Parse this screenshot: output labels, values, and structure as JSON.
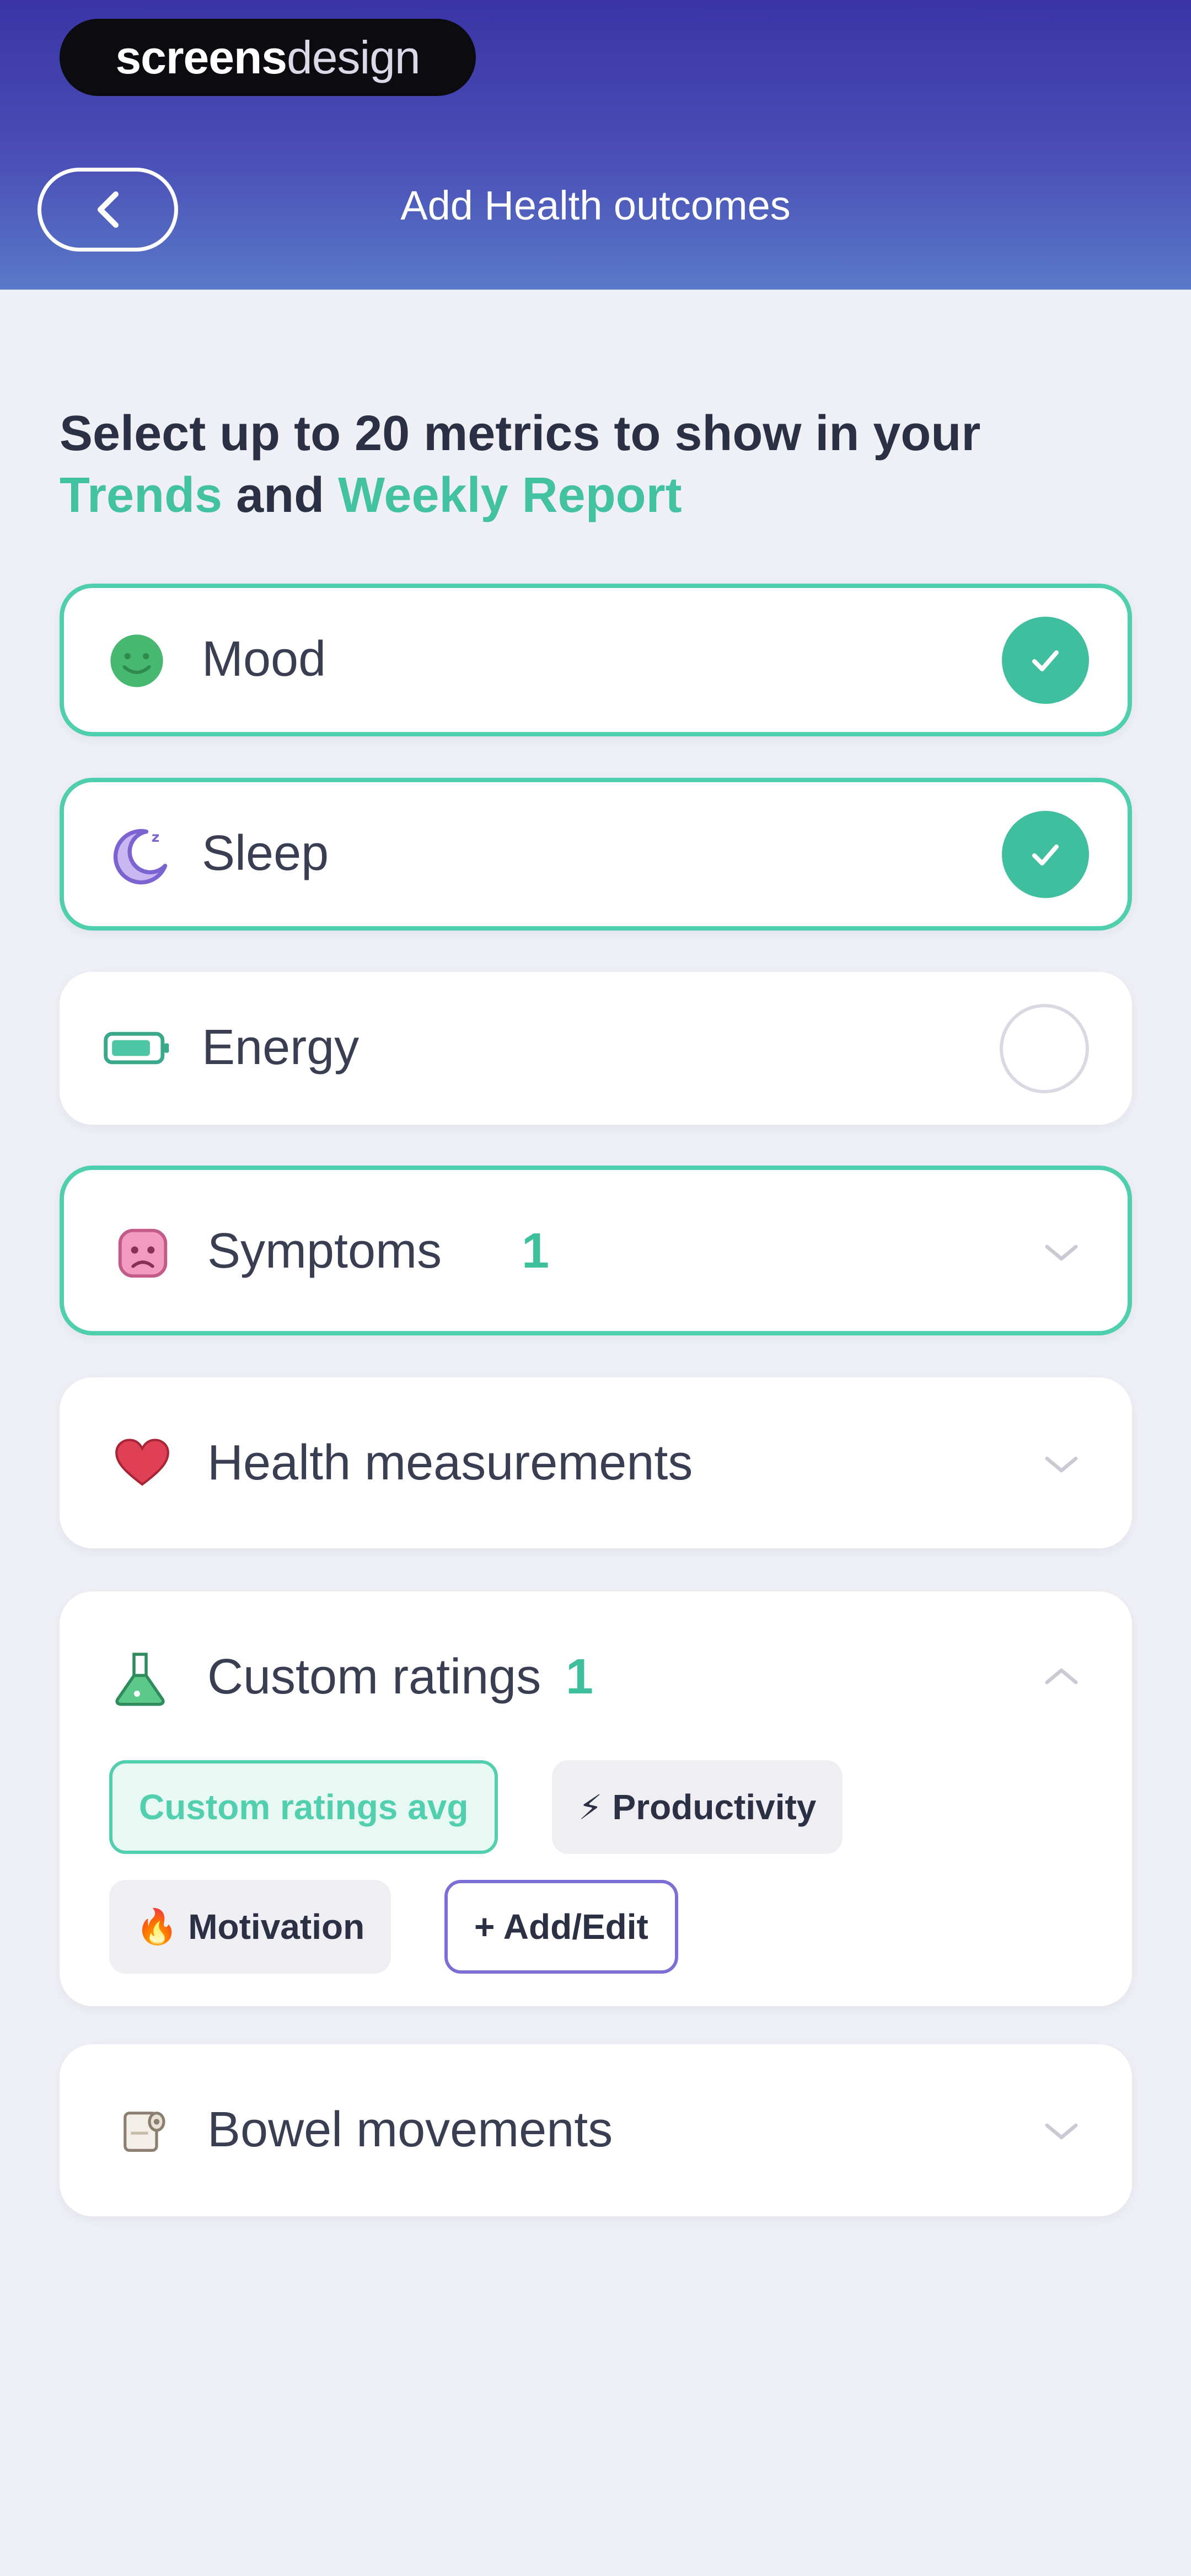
{
  "brand": {
    "strong": "screens",
    "light": "design"
  },
  "header": {
    "title": "Add Health outcomes",
    "back_icon": "chevron-left-icon"
  },
  "intro": {
    "line1": "Select up to 20 metrics to show in your",
    "trends": "Trends",
    "and": " and ",
    "weekly_report": "Weekly Report"
  },
  "metrics": [
    {
      "label": "Mood",
      "icon": "mood-face-icon",
      "state": "checked"
    },
    {
      "label": "Sleep",
      "icon": "moon-icon",
      "state": "checked"
    },
    {
      "label": "Energy",
      "icon": "battery-icon",
      "state": "unchecked"
    }
  ],
  "sections": {
    "symptoms": {
      "label": "Symptoms",
      "count": "1",
      "icon": "symptoms-icon",
      "state": "collapsed"
    },
    "health_measurements": {
      "label": "Health measurements",
      "icon": "heart-icon",
      "state": "collapsed"
    },
    "custom_ratings": {
      "label": "Custom ratings",
      "count": "1",
      "icon": "flask-icon",
      "state": "expanded",
      "chips": {
        "avg": "Custom ratings avg",
        "productivity": "Productivity",
        "productivity_emoji": "⚡",
        "motivation": "Motivation",
        "motivation_emoji": "🔥",
        "add_edit": "+ Add/Edit"
      }
    },
    "bowel_movements": {
      "label": "Bowel movements",
      "icon": "toilet-paper-icon",
      "state": "collapsed"
    }
  },
  "colors": {
    "accent": "#43c2a2",
    "header_top": "#3a34a6",
    "header_bottom": "#5a79c8",
    "chip_outline": "#7b6fd6"
  }
}
